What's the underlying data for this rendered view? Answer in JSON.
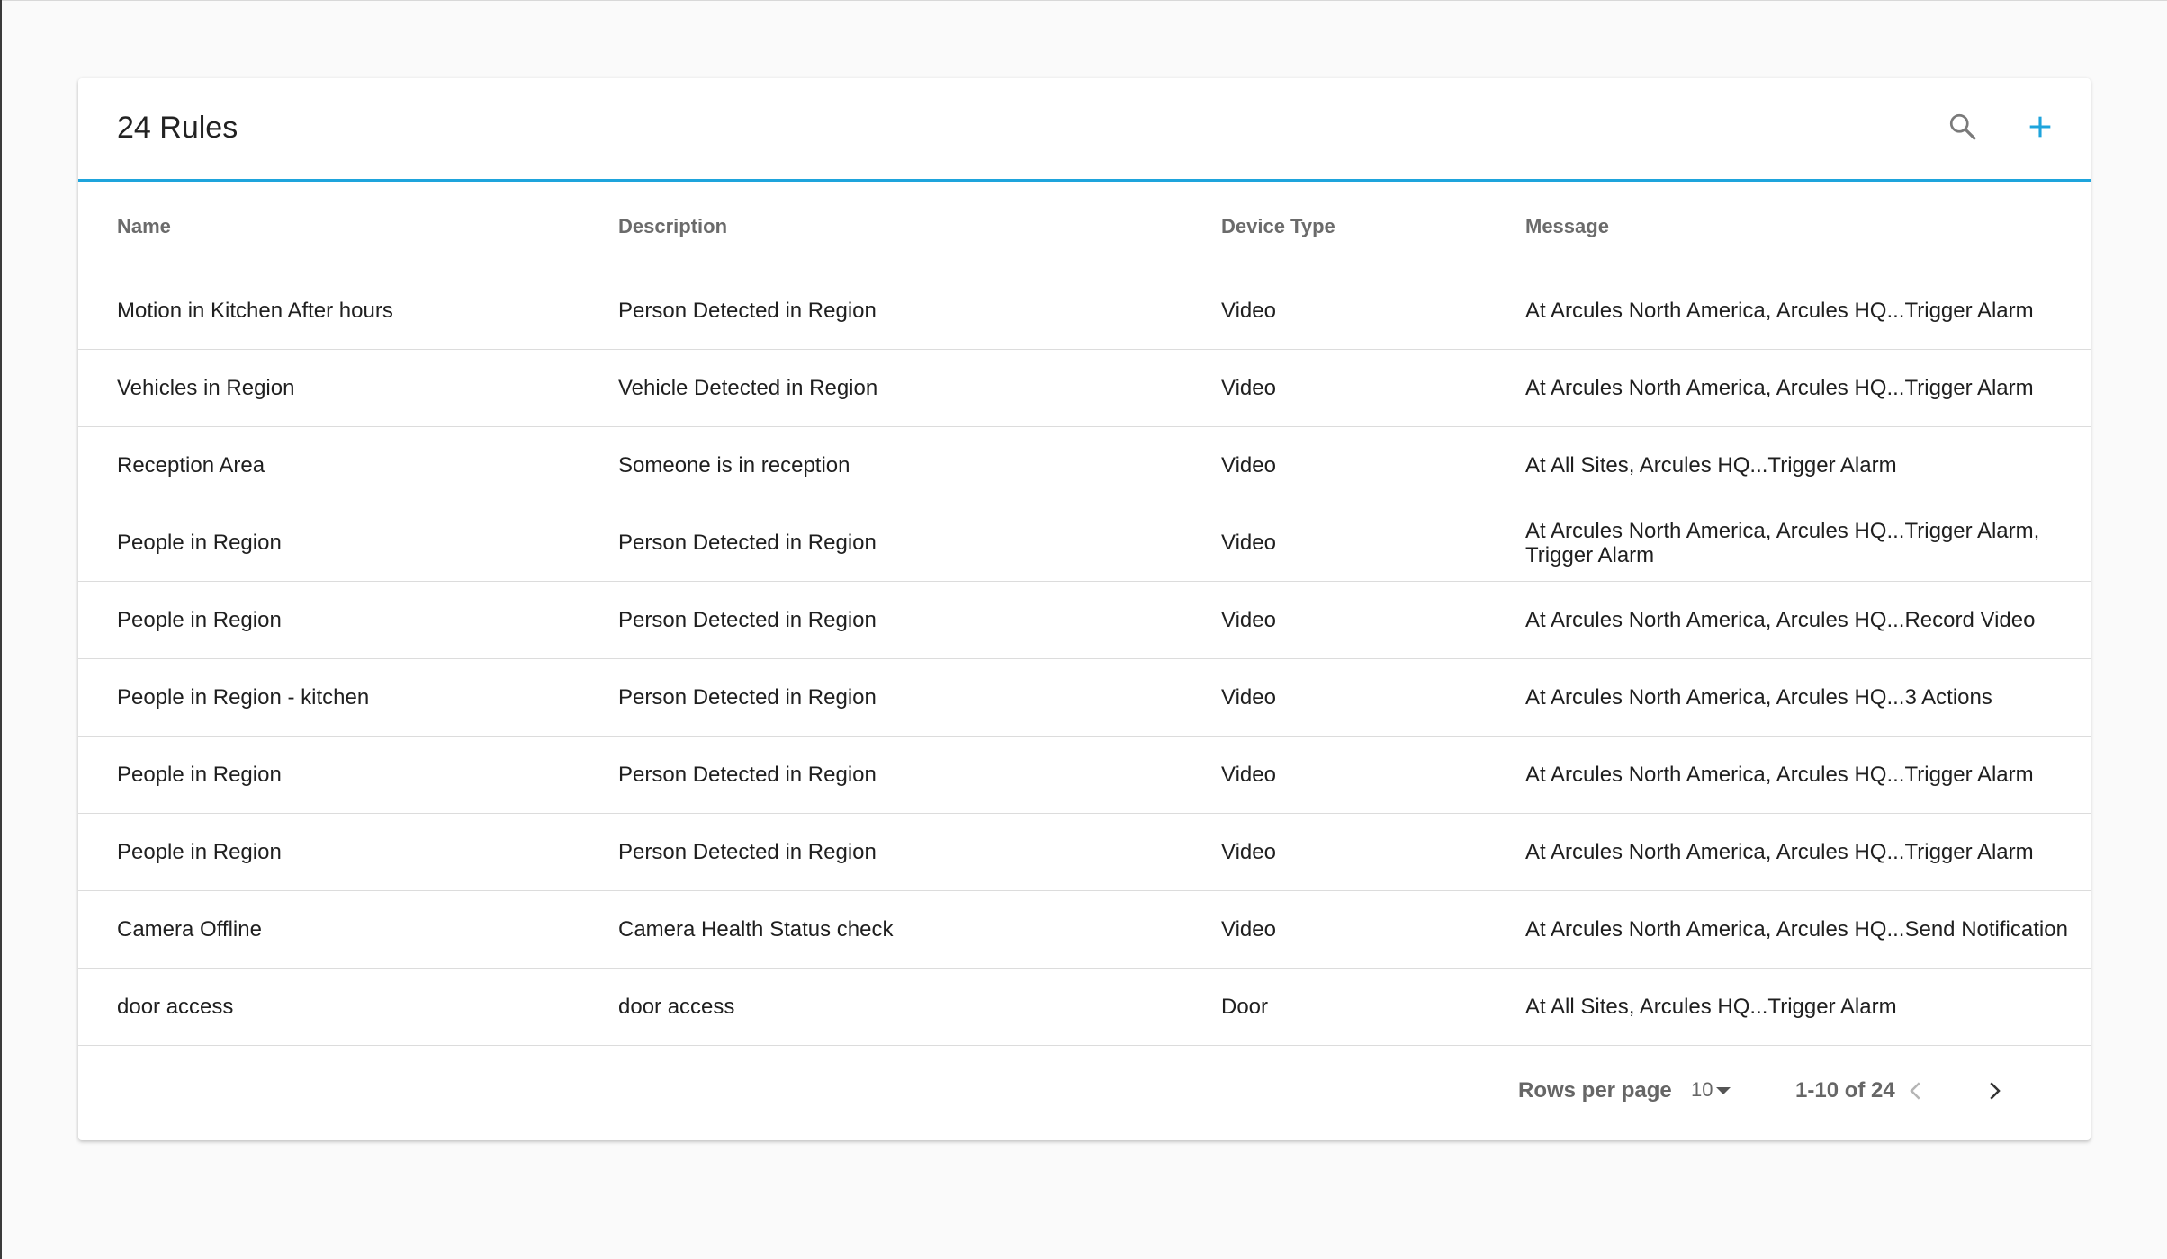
{
  "header": {
    "title": "24 Rules",
    "search_icon": "search-icon",
    "add_icon": "plus-icon",
    "accent_color": "#1ea4dc"
  },
  "table": {
    "columns": [
      "Name",
      "Description",
      "Device Type",
      "Message"
    ],
    "rows": [
      {
        "name": "Motion in Kitchen After hours",
        "description": "Person Detected in Region",
        "device_type": "Video",
        "message": "At Arcules North America, Arcules HQ...Trigger Alarm"
      },
      {
        "name": "Vehicles in Region",
        "description": "Vehicle Detected in Region",
        "device_type": "Video",
        "message": "At Arcules North America, Arcules HQ...Trigger Alarm"
      },
      {
        "name": "Reception Area",
        "description": "Someone is in reception",
        "device_type": "Video",
        "message": "At All Sites, Arcules HQ...Trigger Alarm"
      },
      {
        "name": "People in Region",
        "description": "Person Detected in Region",
        "device_type": "Video",
        "message": "At Arcules North America, Arcules HQ...Trigger Alarm, Trigger Alarm"
      },
      {
        "name": "People in Region",
        "description": "Person Detected in Region",
        "device_type": "Video",
        "message": "At Arcules North America, Arcules HQ...Record Video"
      },
      {
        "name": "People in Region - kitchen",
        "description": "Person Detected in Region",
        "device_type": "Video",
        "message": "At Arcules North America, Arcules HQ...3 Actions"
      },
      {
        "name": "People in Region",
        "description": "Person Detected in Region",
        "device_type": "Video",
        "message": "At Arcules North America, Arcules HQ...Trigger Alarm"
      },
      {
        "name": "People in Region",
        "description": "Person Detected in Region",
        "device_type": "Video",
        "message": "At Arcules North America, Arcules HQ...Trigger Alarm"
      },
      {
        "name": "Camera Offline",
        "description": "Camera Health Status check",
        "device_type": "Video",
        "message": "At Arcules North America, Arcules HQ...Send Notification"
      },
      {
        "name": "door access",
        "description": "door access",
        "device_type": "Door",
        "message": "At All Sites, Arcules HQ...Trigger Alarm"
      }
    ]
  },
  "pagination": {
    "rows_per_page_label": "Rows per page",
    "rows_per_page_value": "10",
    "range_text": "1-10 of 24",
    "prev_icon": "chevron-left-icon",
    "next_icon": "chevron-right-icon"
  }
}
